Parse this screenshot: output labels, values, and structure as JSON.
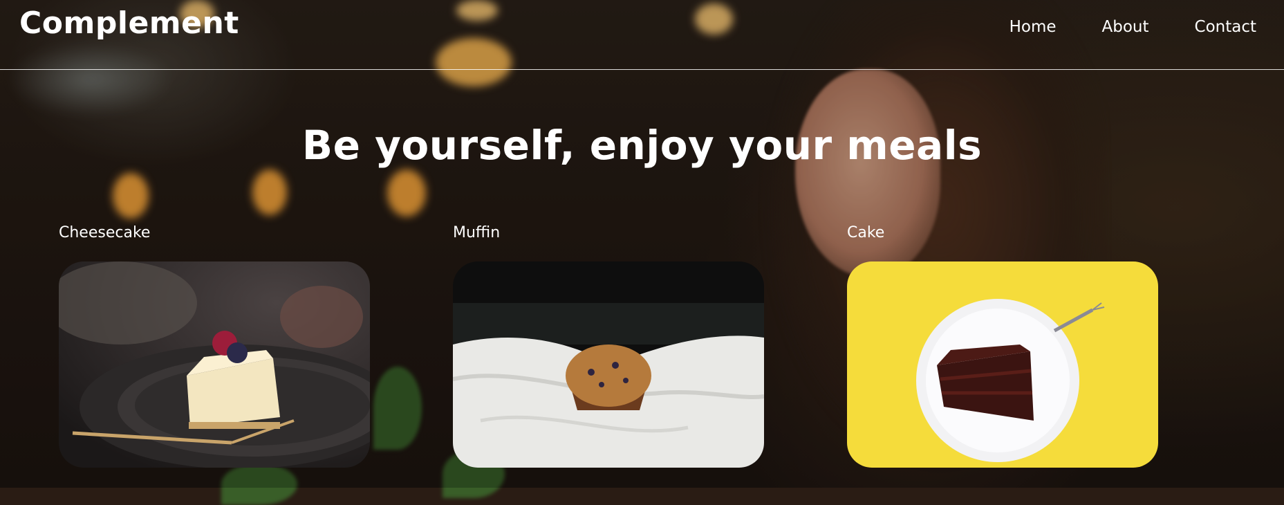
{
  "header": {
    "logo": "Complement",
    "nav": [
      {
        "label": "Home"
      },
      {
        "label": "About"
      },
      {
        "label": "Contact"
      }
    ]
  },
  "hero": {
    "headline": "Be yourself, enjoy your meals"
  },
  "cards": [
    {
      "title": "Cheesecake",
      "image_icon": "cheesecake-photo"
    },
    {
      "title": "Muffin",
      "image_icon": "muffin-photo"
    },
    {
      "title": "Cake",
      "image_icon": "chocolate-cake-photo"
    }
  ],
  "colors": {
    "text": "#ffffff",
    "cake_background": "#f5dc3b"
  }
}
